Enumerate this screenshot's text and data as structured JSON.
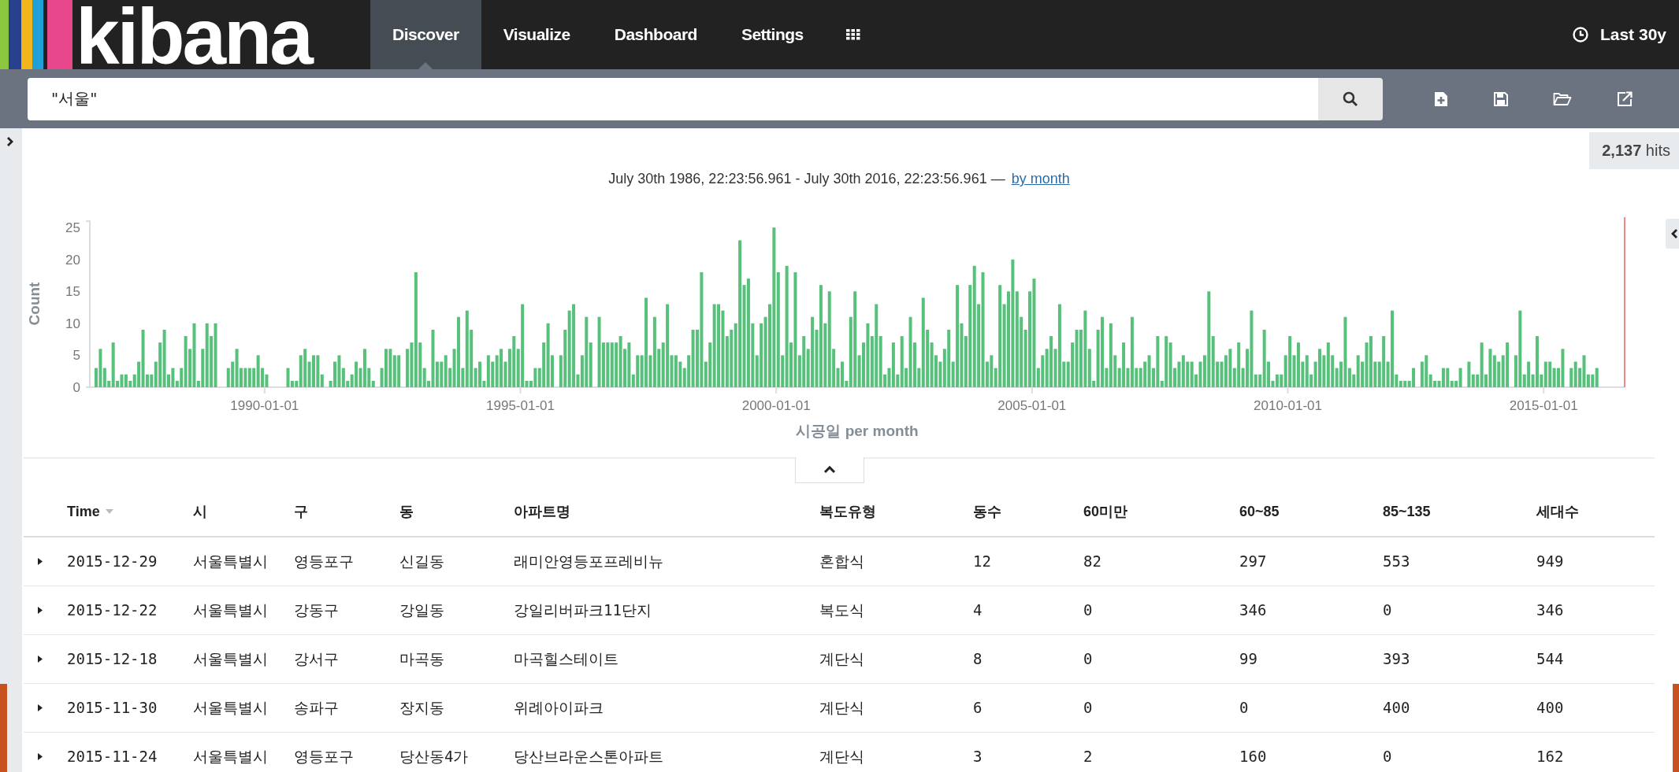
{
  "logo": "kibana",
  "nav": {
    "items": [
      {
        "label": "Discover",
        "selected": true
      },
      {
        "label": "Visualize",
        "selected": false
      },
      {
        "label": "Dashboard",
        "selected": false
      },
      {
        "label": "Settings",
        "selected": false
      }
    ],
    "time_range": "Last 30y"
  },
  "search": {
    "value": "\"서울\""
  },
  "hits": {
    "count": "2,137",
    "label": "hits"
  },
  "time_summary": {
    "range": "July 30th 1986, 22:23:56.961 - July 30th 2016, 22:23:56.961 —",
    "interval_link": "by month"
  },
  "histogram_date_labels": [
    "1990-01-01",
    "1995-01-01",
    "2000-01-01",
    "2005-01-01",
    "2010-01-01",
    "2015-01-01"
  ],
  "chart_data": {
    "type": "bar",
    "xlabel": "시공일 per month",
    "ylabel": "Count",
    "ylim": [
      0,
      26
    ],
    "yticks": [
      0,
      5,
      10,
      15,
      20,
      25
    ],
    "values": [
      0,
      3,
      6,
      3,
      1,
      7,
      1,
      2,
      2,
      1,
      2,
      4,
      9,
      2,
      2,
      4,
      7,
      9,
      2,
      3,
      1,
      3,
      8,
      6,
      10,
      1,
      6,
      10,
      8,
      10,
      0,
      0,
      3,
      4,
      6,
      3,
      3,
      3,
      3,
      5,
      3,
      2,
      0,
      0,
      0,
      0,
      3,
      1,
      1,
      5,
      6,
      4,
      5,
      5,
      2,
      0,
      1,
      4,
      5,
      3,
      1,
      2,
      4,
      3,
      6,
      3,
      1,
      0,
      3,
      6,
      6,
      5,
      5,
      0,
      6,
      7,
      18,
      7,
      3,
      1,
      9,
      4,
      4,
      5,
      3,
      6,
      11,
      3,
      12,
      9,
      3,
      4,
      1,
      5,
      4,
      5,
      6,
      4,
      6,
      8,
      6,
      13,
      1,
      1,
      3,
      3,
      7,
      10,
      5,
      0,
      5,
      9,
      12,
      13,
      2,
      5,
      11,
      7,
      0,
      11,
      7,
      7,
      7,
      7,
      8,
      6,
      7,
      2,
      5,
      5,
      14,
      5,
      11,
      6,
      7,
      13,
      5,
      5,
      4,
      3,
      5,
      9,
      9,
      18,
      4,
      7,
      13,
      13,
      12,
      8,
      9,
      10,
      23,
      16,
      17,
      10,
      5,
      10,
      11,
      13,
      25,
      18,
      5,
      19,
      7,
      18,
      5,
      8,
      6,
      11,
      9,
      16,
      10,
      15,
      6,
      3,
      4,
      1,
      11,
      15,
      5,
      7,
      10,
      8,
      13,
      8,
      2,
      3,
      7,
      2,
      8,
      3,
      11,
      7,
      3,
      14,
      9,
      7,
      5,
      4,
      6,
      9,
      4,
      16,
      10,
      8,
      16,
      19,
      13,
      18,
      4,
      5,
      3,
      16,
      13,
      15,
      20,
      15,
      11,
      9,
      15,
      17,
      3,
      5,
      6,
      8,
      6,
      13,
      4,
      4,
      7,
      9,
      9,
      12,
      6,
      1,
      9,
      11,
      3,
      10,
      5,
      3,
      7,
      3,
      11,
      3,
      3,
      4,
      5,
      3,
      8,
      1,
      8,
      7,
      3,
      4,
      5,
      4,
      4,
      2,
      4,
      5,
      15,
      8,
      4,
      4,
      5,
      6,
      3,
      7,
      3,
      6,
      12,
      2,
      2,
      9,
      4,
      1,
      2,
      2,
      5,
      8,
      5,
      7,
      4,
      5,
      2,
      4,
      6,
      5,
      7,
      5,
      3,
      4,
      11,
      3,
      2,
      5,
      4,
      7,
      8,
      4,
      4,
      8,
      4,
      12,
      2,
      1,
      1,
      1,
      3,
      0,
      4,
      5,
      2,
      1,
      1,
      3,
      3,
      1,
      1,
      3,
      0,
      4,
      2,
      2,
      7,
      2,
      6,
      5,
      4,
      5,
      7,
      0,
      5,
      12,
      2,
      4,
      2,
      8,
      2,
      4,
      4,
      3,
      3,
      6,
      0,
      3,
      4,
      3,
      5,
      2,
      2,
      3,
      0,
      0,
      0,
      0,
      0,
      0
    ]
  },
  "table": {
    "columns": [
      {
        "label": "Time",
        "sorted": true
      },
      {
        "label": "시",
        "sorted": false
      },
      {
        "label": "구",
        "sorted": false
      },
      {
        "label": "동",
        "sorted": false
      },
      {
        "label": "아파트명",
        "sorted": false
      },
      {
        "label": "복도유형",
        "sorted": false
      },
      {
        "label": "동수",
        "sorted": false
      },
      {
        "label": "60미만",
        "sorted": false
      },
      {
        "label": "60~85",
        "sorted": false
      },
      {
        "label": "85~135",
        "sorted": false
      },
      {
        "label": "세대수",
        "sorted": false
      }
    ],
    "rows": [
      [
        "2015-12-29",
        "서울특별시",
        "영등포구",
        "신길동",
        "래미안영등포프레비뉴",
        "혼합식",
        "12",
        "82",
        "297",
        "553",
        "949"
      ],
      [
        "2015-12-22",
        "서울특별시",
        "강동구",
        "강일동",
        "강일리버파크11단지",
        "복도식",
        "4",
        "0",
        "346",
        "0",
        "346"
      ],
      [
        "2015-12-18",
        "서울특별시",
        "강서구",
        "마곡동",
        "마곡힐스테이트",
        "계단식",
        "8",
        "0",
        "99",
        "393",
        "544"
      ],
      [
        "2015-11-30",
        "서울특별시",
        "송파구",
        "장지동",
        "위례아이파크",
        "계단식",
        "6",
        "0",
        "0",
        "400",
        "400"
      ],
      [
        "2015-11-24",
        "서울특별시",
        "영등포구",
        "당산동4가",
        "당산브라운스톤아파트",
        "계단식",
        "3",
        "2",
        "160",
        "0",
        "162"
      ]
    ]
  }
}
